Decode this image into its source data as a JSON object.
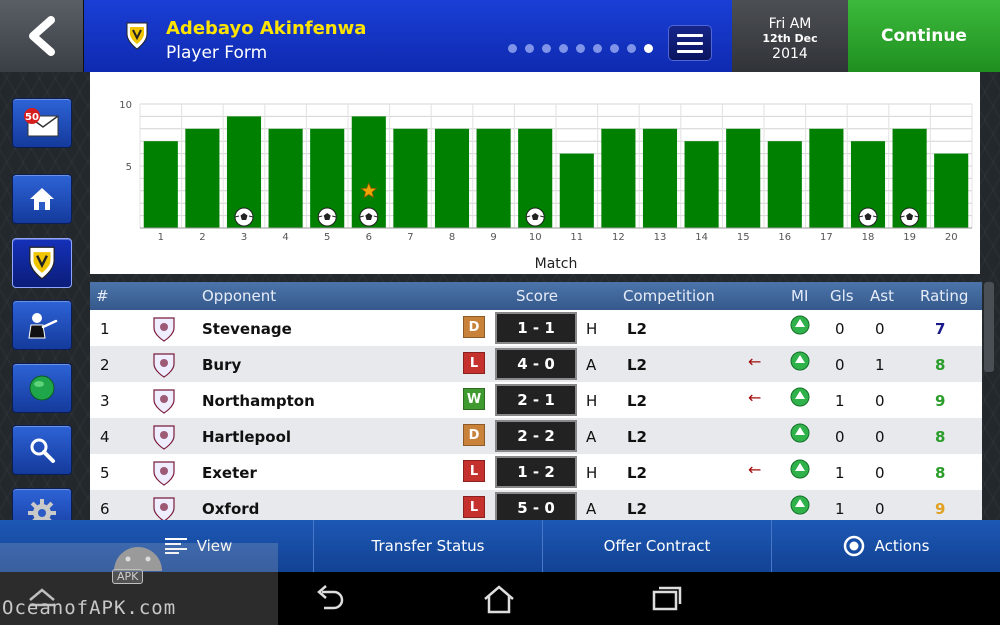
{
  "header": {
    "player_name": "Adebayo Akinfenwa",
    "screen_title": "Player Form",
    "page_dots_total": 9,
    "page_dots_active_index": 8,
    "date": {
      "day_time": "Fri AM",
      "day_month": "12th Dec",
      "year": "2014"
    },
    "continue_label": "Continue"
  },
  "sidebar": {
    "items": [
      {
        "name": "inbox",
        "icon": "mail-icon",
        "badge": "50"
      },
      {
        "name": "home",
        "icon": "home-icon"
      },
      {
        "name": "club",
        "icon": "club-crest-icon",
        "active": true
      },
      {
        "name": "manager",
        "icon": "manager-icon"
      },
      {
        "name": "world",
        "icon": "globe-icon"
      },
      {
        "name": "search",
        "icon": "search-icon"
      },
      {
        "name": "settings",
        "icon": "gear-icon"
      }
    ]
  },
  "chart_data": {
    "type": "bar",
    "xlabel": "Match",
    "ylabel": "",
    "ylim": [
      0,
      10
    ],
    "yticks": [
      5,
      10
    ],
    "categories": [
      "1",
      "2",
      "3",
      "4",
      "5",
      "6",
      "7",
      "8",
      "9",
      "10",
      "11",
      "12",
      "13",
      "14",
      "15",
      "16",
      "17",
      "18",
      "19",
      "20"
    ],
    "values": [
      7,
      8,
      9,
      8,
      8,
      9,
      8,
      8,
      8,
      8,
      6,
      8,
      8,
      7,
      8,
      7,
      8,
      7,
      8,
      6
    ],
    "goal_markers": [
      3,
      5,
      6,
      10,
      18,
      19
    ],
    "star_markers": [
      6
    ],
    "bar_color": "#008000"
  },
  "table": {
    "columns": [
      "#",
      "Opponent",
      "Score",
      "Competition",
      "MI",
      "Gls",
      "Ast",
      "Rating"
    ],
    "rows": [
      {
        "num": "1",
        "opponent": "Stevenage",
        "result": "D",
        "score": "1 - 1",
        "venue": "H",
        "comp": "L2",
        "arrow": "",
        "gls": "0",
        "ast": "0",
        "rating": "7"
      },
      {
        "num": "2",
        "opponent": "Bury",
        "result": "L",
        "score": "4 - 0",
        "venue": "A",
        "comp": "L2",
        "arrow": "←",
        "gls": "0",
        "ast": "1",
        "rating": "8"
      },
      {
        "num": "3",
        "opponent": "Northampton",
        "result": "W",
        "score": "2 - 1",
        "venue": "H",
        "comp": "L2",
        "arrow": "←",
        "gls": "1",
        "ast": "0",
        "rating": "9"
      },
      {
        "num": "4",
        "opponent": "Hartlepool",
        "result": "D",
        "score": "2 - 2",
        "venue": "A",
        "comp": "L2",
        "arrow": "",
        "gls": "0",
        "ast": "0",
        "rating": "8"
      },
      {
        "num": "5",
        "opponent": "Exeter",
        "result": "L",
        "score": "1 - 2",
        "venue": "H",
        "comp": "L2",
        "arrow": "←",
        "gls": "1",
        "ast": "0",
        "rating": "8"
      },
      {
        "num": "6",
        "opponent": "Oxford",
        "result": "L",
        "score": "5 - 0",
        "venue": "A",
        "comp": "L2",
        "arrow": "",
        "gls": "1",
        "ast": "0",
        "rating": "9"
      }
    ],
    "result_colors": {
      "W": "#3f9a2f",
      "D": "#c8823a",
      "L": "#c5312c"
    },
    "rating_colors": {
      "7": "#1a1a8a",
      "8": "#2a9d2a",
      "9": "#2a9d2a"
    },
    "rating_color_row6": "#e0a020"
  },
  "actionbar": {
    "view_label": "View",
    "transfer_label": "Transfer Status",
    "offer_label": "Offer Contract",
    "actions_label": "Actions"
  },
  "watermark": {
    "text": "OceanofAPK.com",
    "badge": "APK"
  }
}
